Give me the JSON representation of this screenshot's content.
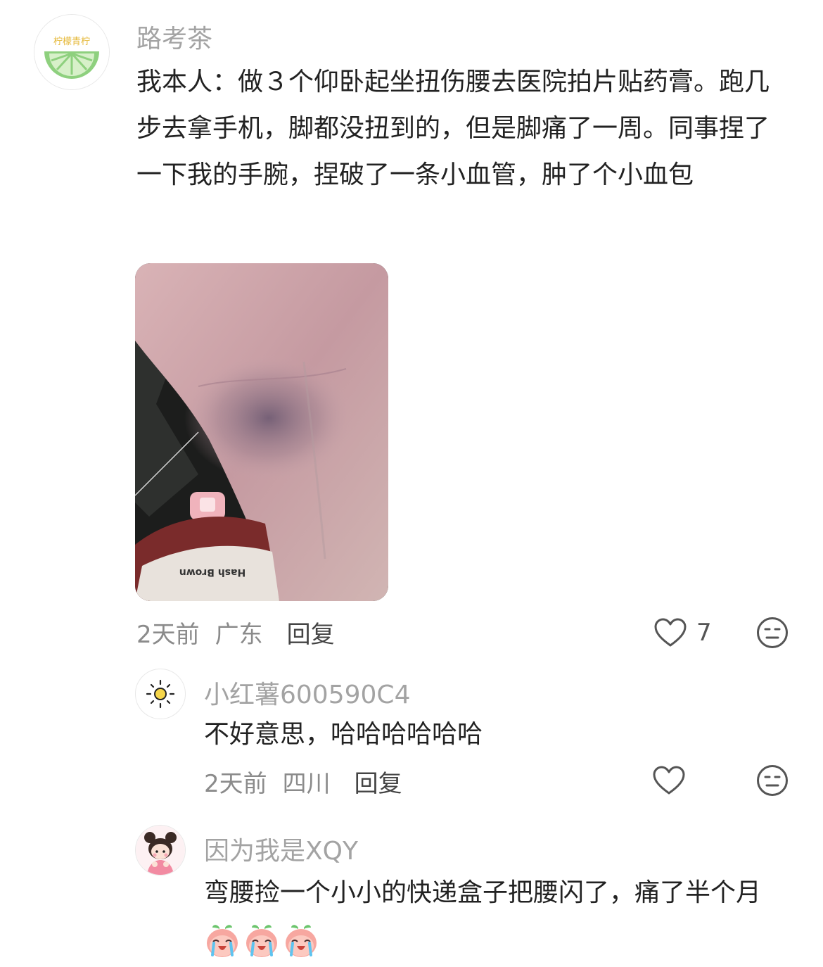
{
  "comments": [
    {
      "username": "路考茶",
      "avatar_text": "柠檬青柠",
      "text": "我本人：做３个仰卧起坐扭伤腰去医院拍片贴药膏。跑几步去拿手机，脚都没扭到的，但是脚痛了一周。同事捏了一下我的手腕，捏破了一条小血管，肿了个小血包",
      "image_caption": "Hash Brown",
      "time": "2天前",
      "location": "广东",
      "reply_label": "回复",
      "like_count": "7"
    },
    {
      "username": "小红薯600590C4",
      "avatar_icon": "sun-icon",
      "text": "不好意思，哈哈哈哈哈哈",
      "time": "2天前",
      "location": "四川",
      "reply_label": "回复",
      "like_count": ""
    },
    {
      "username": "因为我是XQY",
      "avatar_icon": "cartoon-girl-avatar",
      "text": "弯腰捡一个小小的快递盒子把腰闪了，痛了半个月",
      "emojis": [
        "crying-peach-icon",
        "crying-peach-icon",
        "crying-peach-icon"
      ]
    }
  ],
  "colors": {
    "username": "#a3a3a3",
    "meta": "#8b8b8b",
    "text": "#222222",
    "lime_green": "#7ccf6e"
  }
}
